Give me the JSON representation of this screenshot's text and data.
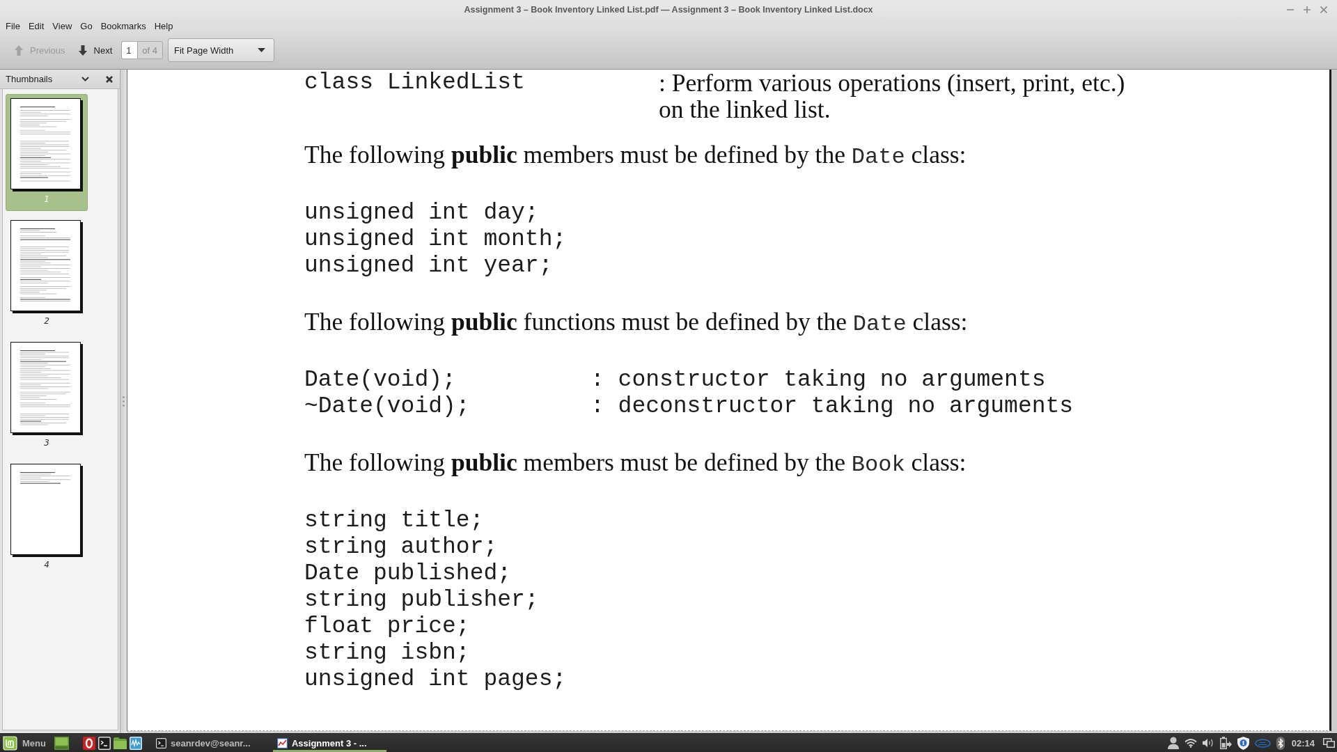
{
  "window": {
    "title": "Assignment 3 – Book Inventory Linked List.pdf — Assignment 3 – Book Inventory Linked List.docx"
  },
  "menu_bar": [
    "File",
    "Edit",
    "View",
    "Go",
    "Bookmarks",
    "Help"
  ],
  "toolbar": {
    "previous": {
      "label": "Previous",
      "disabled": true
    },
    "next": {
      "label": "Next",
      "disabled": false
    },
    "page": {
      "value": "1",
      "total": "of 4"
    },
    "zoom": {
      "value": "Fit Page Width"
    }
  },
  "sidebar": {
    "title": "Thumbnails",
    "thumbnails": [
      {
        "label": "1",
        "selected": true
      },
      {
        "label": "2",
        "selected": false
      },
      {
        "label": "3",
        "selected": false
      },
      {
        "label": "4",
        "selected": false
      }
    ]
  },
  "document": {
    "blocks": [
      {
        "kind": "definition",
        "term": "class LinkedList",
        "lines": [
          ": Perform various operations (insert, print, etc.)",
          "on the linked list."
        ]
      },
      {
        "kind": "paragraph",
        "segments": [
          {
            "kind": "text",
            "text": "The following **public** members must be defined by the "
          },
          {
            "kind": "code",
            "text": "Date"
          },
          {
            "kind": "text",
            "text": " class:"
          }
        ]
      },
      {
        "kind": "code",
        "lines": [
          "unsigned int day;",
          "unsigned int month;",
          "unsigned int year;"
        ]
      },
      {
        "kind": "paragraph",
        "segments": [
          {
            "kind": "text",
            "text": "The following **public** functions must be defined by the "
          },
          {
            "kind": "code",
            "text": "Date"
          },
          {
            "kind": "text",
            "text": " class:"
          }
        ]
      },
      {
        "kind": "code_table",
        "rows": [
          {
            "left": "Date(void);",
            "right": ": constructor taking no arguments"
          },
          {
            "left": "~Date(void);",
            "right": ": deconstructor taking no arguments"
          }
        ]
      },
      {
        "kind": "paragraph",
        "segments": [
          {
            "kind": "text",
            "text": "The following **public** members must be defined by the "
          },
          {
            "kind": "code",
            "text": "Book"
          },
          {
            "kind": "text",
            "text": " class:"
          }
        ]
      },
      {
        "kind": "code",
        "lines": [
          "string title;",
          "string author;",
          "Date published;",
          "string publisher;",
          "float price;",
          "string isbn;",
          "unsigned int pages;"
        ]
      }
    ]
  },
  "taskbar": {
    "menu_label": "Menu",
    "windows": [
      {
        "kind": "terminal",
        "label": "seanrdev@seanr...",
        "selected": false
      },
      {
        "kind": "viewer",
        "label": "Assignment 3 - ...",
        "selected": true
      }
    ],
    "clock": "02:14"
  }
}
